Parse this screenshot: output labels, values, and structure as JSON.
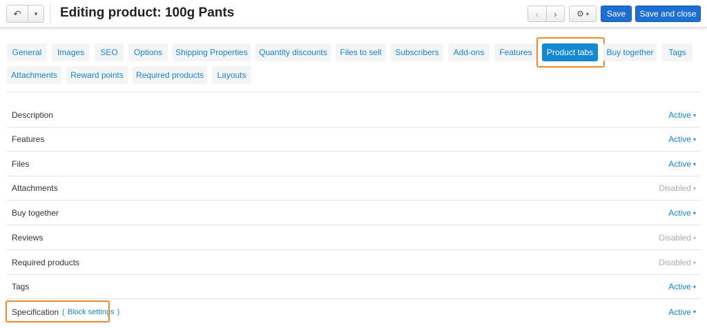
{
  "header": {
    "title": "Editing product: 100g Pants",
    "back_icon": "↶",
    "dropdown_caret": "▾",
    "prev_icon": "‹",
    "next_icon": "›",
    "gear_icon": "⚙",
    "save_label": "Save",
    "save_close_label": "Save and close"
  },
  "tabs": [
    {
      "label": "General"
    },
    {
      "label": "Images"
    },
    {
      "label": "SEO"
    },
    {
      "label": "Options"
    },
    {
      "label": "Shipping Properties"
    },
    {
      "label": "Quantity discounts"
    },
    {
      "label": "Files to sell"
    },
    {
      "label": "Subscribers"
    },
    {
      "label": "Add-ons"
    },
    {
      "label": "Features"
    },
    {
      "label": "Product tabs",
      "active": true
    },
    {
      "label": "Buy together"
    },
    {
      "label": "Tags"
    },
    {
      "label": "Attachments"
    },
    {
      "label": "Reward points"
    },
    {
      "label": "Required products"
    },
    {
      "label": "Layouts"
    }
  ],
  "product_tabs": [
    {
      "name": "Description",
      "status": "Active"
    },
    {
      "name": "Features",
      "status": "Active"
    },
    {
      "name": "Files",
      "status": "Active"
    },
    {
      "name": "Attachments",
      "status": "Disabled"
    },
    {
      "name": "Buy together",
      "status": "Active"
    },
    {
      "name": "Reviews",
      "status": "Disabled"
    },
    {
      "name": "Required products",
      "status": "Disabled"
    },
    {
      "name": "Tags",
      "status": "Active"
    },
    {
      "name": "Specification",
      "status": "Active",
      "block_settings": "Block settings",
      "paren_open": "(",
      "paren_close": ")"
    }
  ],
  "colors": {
    "active_status": "#1a82c3",
    "disabled_status": "#aaaaaa",
    "highlight": "#f0882a",
    "primary_button": "#1e6fd0",
    "active_tab": "#1589cf"
  }
}
